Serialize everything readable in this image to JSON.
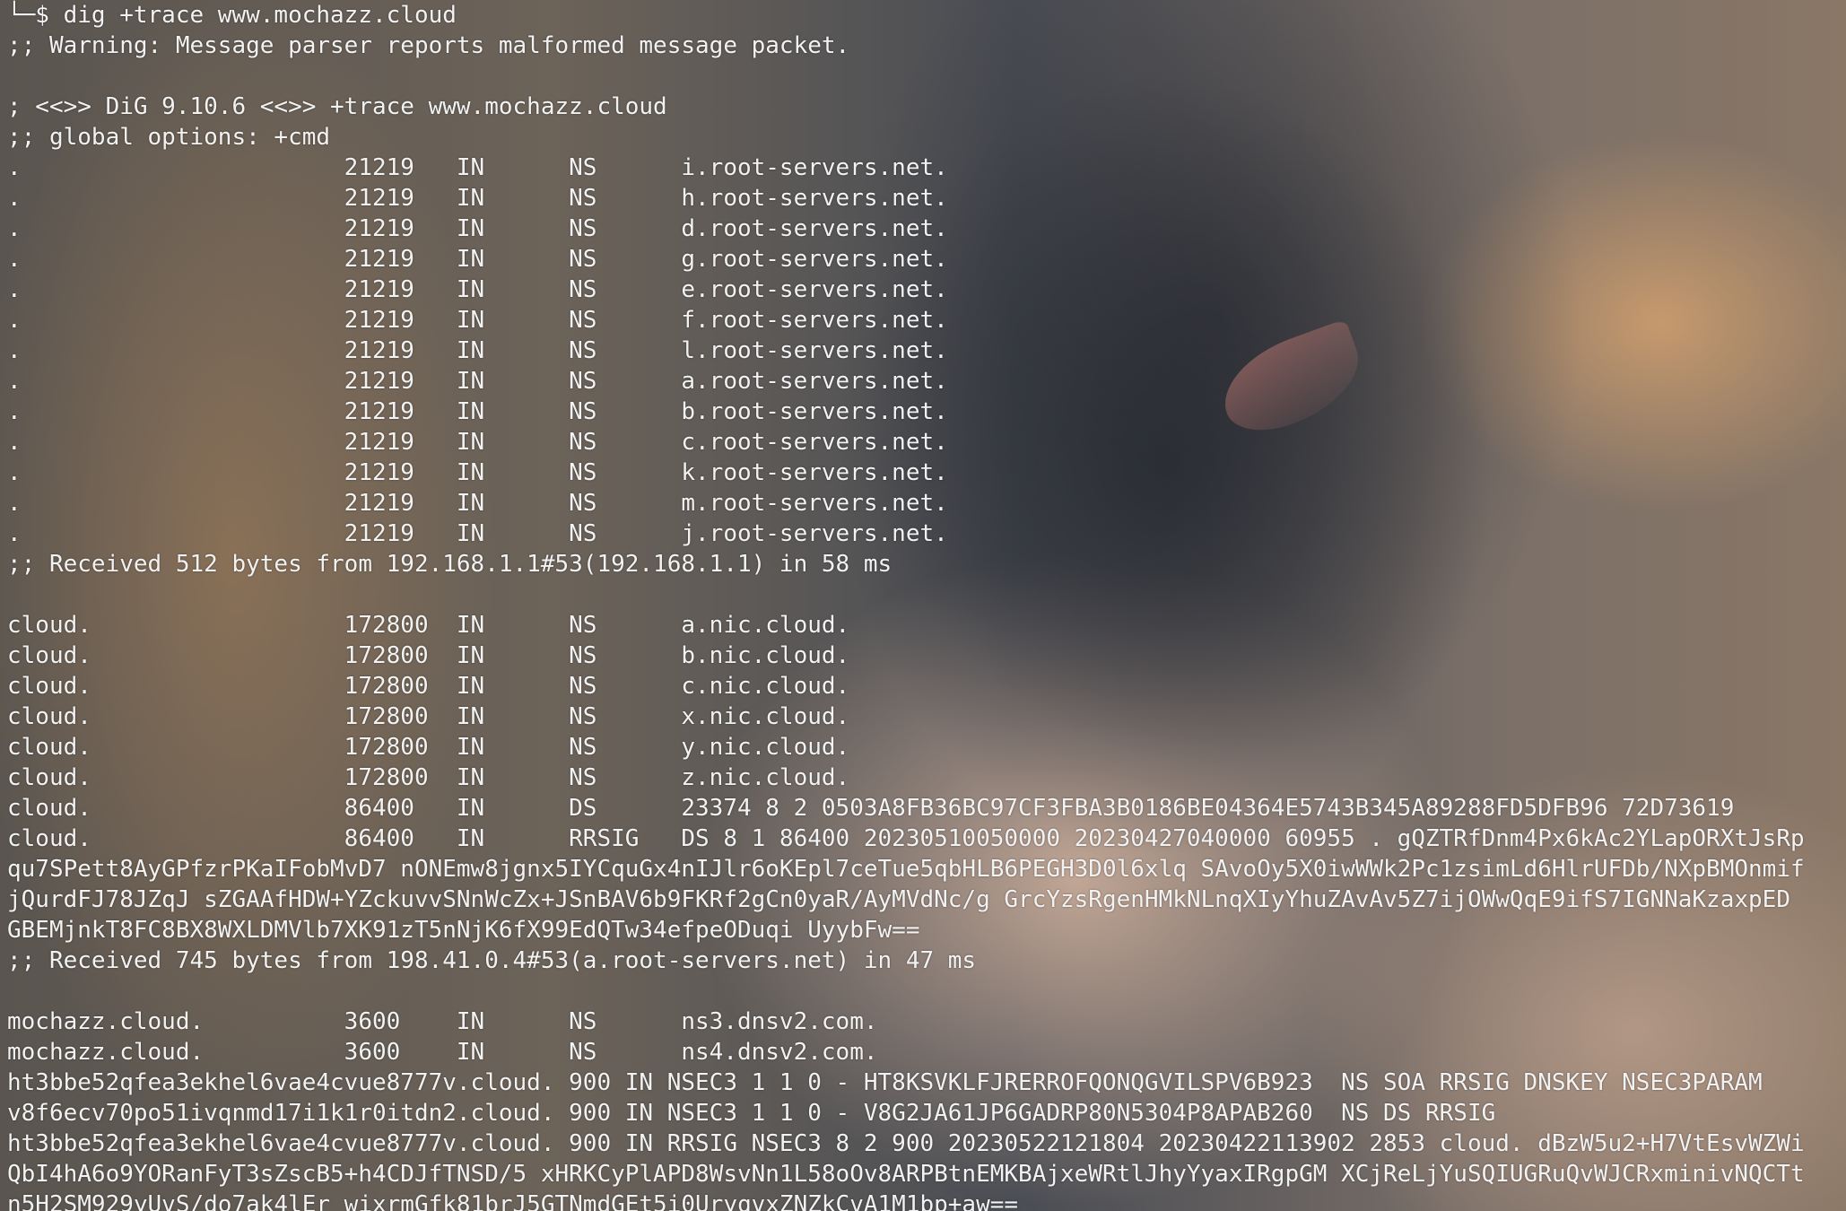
{
  "background": {
    "description_icon": "anime-girl-wallpaper"
  },
  "terminal": {
    "lines": [
      "└─$ dig +trace www.mochazz.cloud",
      ";; Warning: Message parser reports malformed message packet.",
      "",
      "; <<>> DiG 9.10.6 <<>> +trace www.mochazz.cloud",
      ";; global options: +cmd",
      ".                       21219   IN      NS      i.root-servers.net.",
      ".                       21219   IN      NS      h.root-servers.net.",
      ".                       21219   IN      NS      d.root-servers.net.",
      ".                       21219   IN      NS      g.root-servers.net.",
      ".                       21219   IN      NS      e.root-servers.net.",
      ".                       21219   IN      NS      f.root-servers.net.",
      ".                       21219   IN      NS      l.root-servers.net.",
      ".                       21219   IN      NS      a.root-servers.net.",
      ".                       21219   IN      NS      b.root-servers.net.",
      ".                       21219   IN      NS      c.root-servers.net.",
      ".                       21219   IN      NS      k.root-servers.net.",
      ".                       21219   IN      NS      m.root-servers.net.",
      ".                       21219   IN      NS      j.root-servers.net.",
      ";; Received 512 bytes from 192.168.1.1#53(192.168.1.1) in 58 ms",
      "",
      "cloud.                  172800  IN      NS      a.nic.cloud.",
      "cloud.                  172800  IN      NS      b.nic.cloud.",
      "cloud.                  172800  IN      NS      c.nic.cloud.",
      "cloud.                  172800  IN      NS      x.nic.cloud.",
      "cloud.                  172800  IN      NS      y.nic.cloud.",
      "cloud.                  172800  IN      NS      z.nic.cloud.",
      "cloud.                  86400   IN      DS      23374 8 2 0503A8FB36BC97CF3FBA3B0186BE04364E5743B345A89288FD5DFB96 72D73619",
      "cloud.                  86400   IN      RRSIG   DS 8 1 86400 20230510050000 20230427040000 60955 . gQZTRfDnm4Px6kAc2YLapORXtJsRp",
      "qu7SPett8AyGPfzrPKaIFobMvD7 nONEmw8jgnx5IYCquGx4nIJlr6oKEpl7ceTue5qbHLB6PEGH3D0l6xlq SAvoOy5X0iwWWk2Pc1zsimLd6HlrUFDb/NXpBMOnmif",
      "jQurdFJ78JZqJ sZGAAfHDW+YZckuvvSNnWcZx+JSnBAV6b9FKRf2gCn0yaR/AyMVdNc/g GrcYzsRgenHMkNLnqXIyYhuZAvAv5Z7ijOWwQqE9ifS7IGNNaKzaxpED",
      "GBEMjnkT8FC8BX8WXLDMVlb7XK91zT5nNjK6fX99EdQTw34efpeODuqi UyybFw==",
      ";; Received 745 bytes from 198.41.0.4#53(a.root-servers.net) in 47 ms",
      "",
      "mochazz.cloud.          3600    IN      NS      ns3.dnsv2.com.",
      "mochazz.cloud.          3600    IN      NS      ns4.dnsv2.com.",
      "ht3bbe52qfea3ekhel6vae4cvue8777v.cloud. 900 IN NSEC3 1 1 0 - HT8KSVKLFJRERROFQONQGVILSPV6B923  NS SOA RRSIG DNSKEY NSEC3PARAM",
      "v8f6ecv70po51ivqnmd17i1k1r0itdn2.cloud. 900 IN NSEC3 1 1 0 - V8G2JA61JP6GADRP80N5304P8APAB260  NS DS RRSIG",
      "ht3bbe52qfea3ekhel6vae4cvue8777v.cloud. 900 IN RRSIG NSEC3 8 2 900 20230522121804 20230422113902 2853 cloud. dBzW5u2+H7VtEsvWZWi",
      "QbI4hA6o9YORanFyT3sZscB5+h4CDJfTNSD/5 xHRKCyPlAPD8WsvNn1L58oOv8ARPBtnEMKBAjxeWRtlJhyYyaxIRgpGM XCjReLjYuSQIUGRuQvWJCRxminivNQCTt",
      "n5H2SM929yUvS/do7ak4lEr wixrmGfk81brJ5GTNmdGEt5i0UryqvxZNZkCvA1M1bp+aw=="
    ]
  }
}
